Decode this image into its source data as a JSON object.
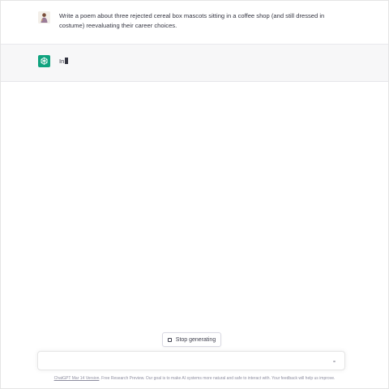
{
  "conversation": {
    "user_message": "Write a poem about three rejected cereal box mascots sitting in a coffee shop (and still dressed in costume) reevaluating their career choices.",
    "assistant_message": "In"
  },
  "controls": {
    "stop_label": "Stop generating",
    "input_placeholder": ""
  },
  "footer": {
    "version_link": "ChatGPT Mar 14 Version",
    "text": ". Free Research Preview. Our goal is to make AI systems more natural and safe to interact with. Your feedback will help us improve."
  },
  "colors": {
    "assistant_bg": "#f7f7f8",
    "bot_avatar": "#10a37f",
    "text": "#343541"
  },
  "icons": {
    "user_avatar": "user-avatar-icon",
    "bot_avatar": "openai-logo-icon",
    "stop": "stop-square-icon",
    "send": "send-icon"
  }
}
